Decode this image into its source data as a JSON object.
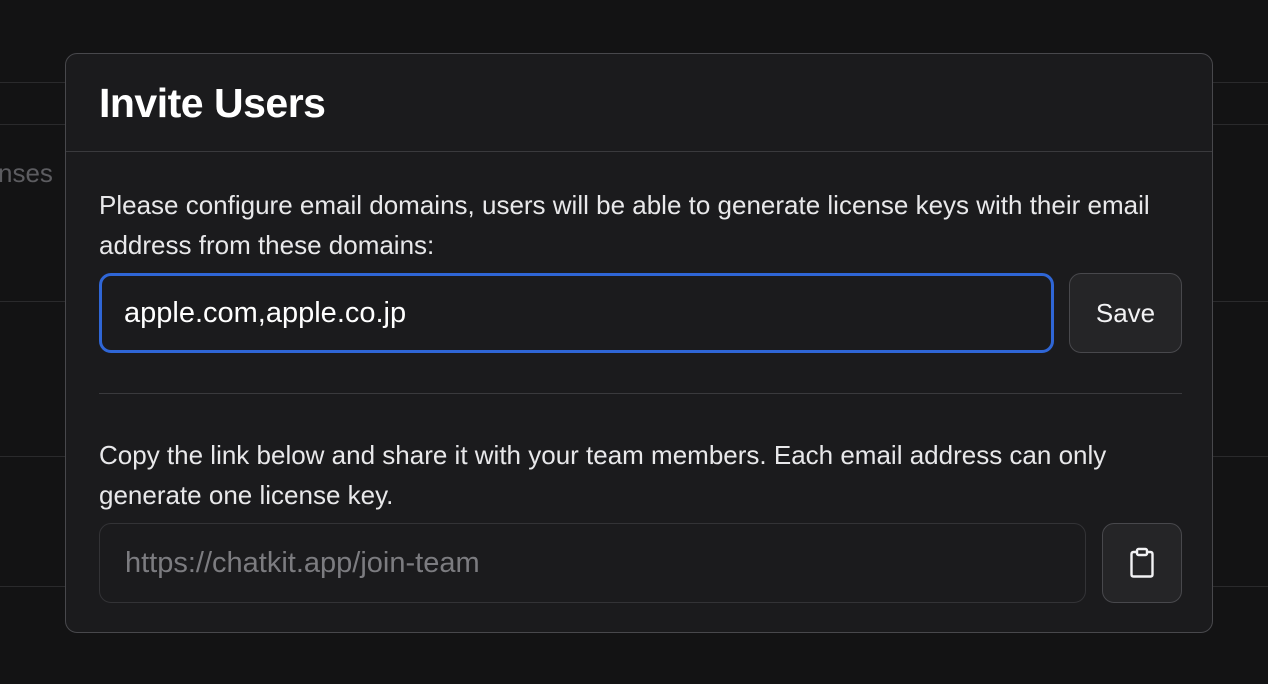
{
  "background": {
    "partial_text": "nses"
  },
  "modal": {
    "title": "Invite Users",
    "domains_description": "Please configure email domains, users will be able to generate license keys with their email address from these domains:",
    "domains_value": "apple.com,apple.co.jp",
    "save_label": "Save",
    "link_description": "Copy the link below and share it with your team members. Each email address can only generate one license key.",
    "link_value": "https://chatkit.app/join-team",
    "copy_icon": "clipboard-icon"
  },
  "colors": {
    "accent_focus": "#2f66d6",
    "surface": "#1b1b1d",
    "backdrop": "#131314"
  }
}
